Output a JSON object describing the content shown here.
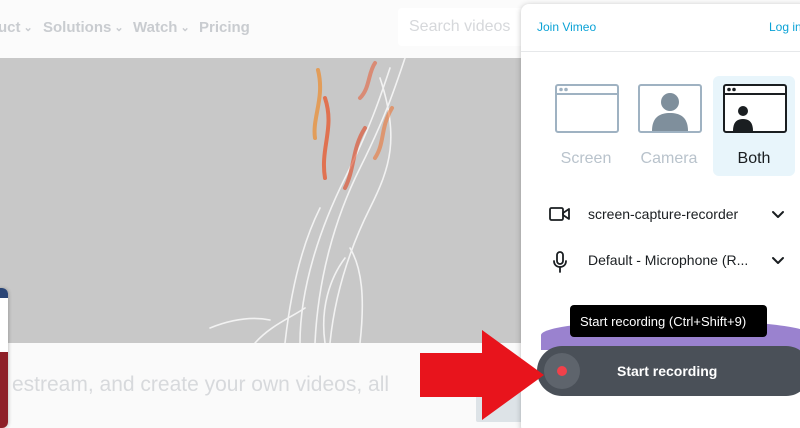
{
  "background_page": {
    "nav": {
      "product": "uct",
      "solutions": "Solutions",
      "watch": "Watch",
      "pricing": "Pricing",
      "search_placeholder": "Search videos"
    },
    "hero_caption": "estream, and create your own videos, all"
  },
  "recorder": {
    "join_link": "Join Vimeo",
    "login_link": "Log in",
    "modes": [
      {
        "label": "Screen",
        "icon": "screen-window-icon"
      },
      {
        "label": "Camera",
        "icon": "camera-person-icon"
      },
      {
        "label": "Both",
        "icon": "screen-and-camera-icon",
        "selected": true
      }
    ],
    "camera_source": {
      "icon": "video-camera-icon",
      "value": "screen-capture-recorder"
    },
    "microphone_source": {
      "icon": "microphone-icon",
      "value": "Default - Microphone (R..."
    },
    "start_button": "Start recording",
    "tooltip": "Start recording (Ctrl+Shift+9)"
  },
  "colors": {
    "link": "#0aa2d6",
    "record_dot": "#f1414a",
    "start_button": "#4a5058",
    "selected_mode_bg": "#e8f5fb",
    "annotation_arrow": "#e8141c"
  }
}
